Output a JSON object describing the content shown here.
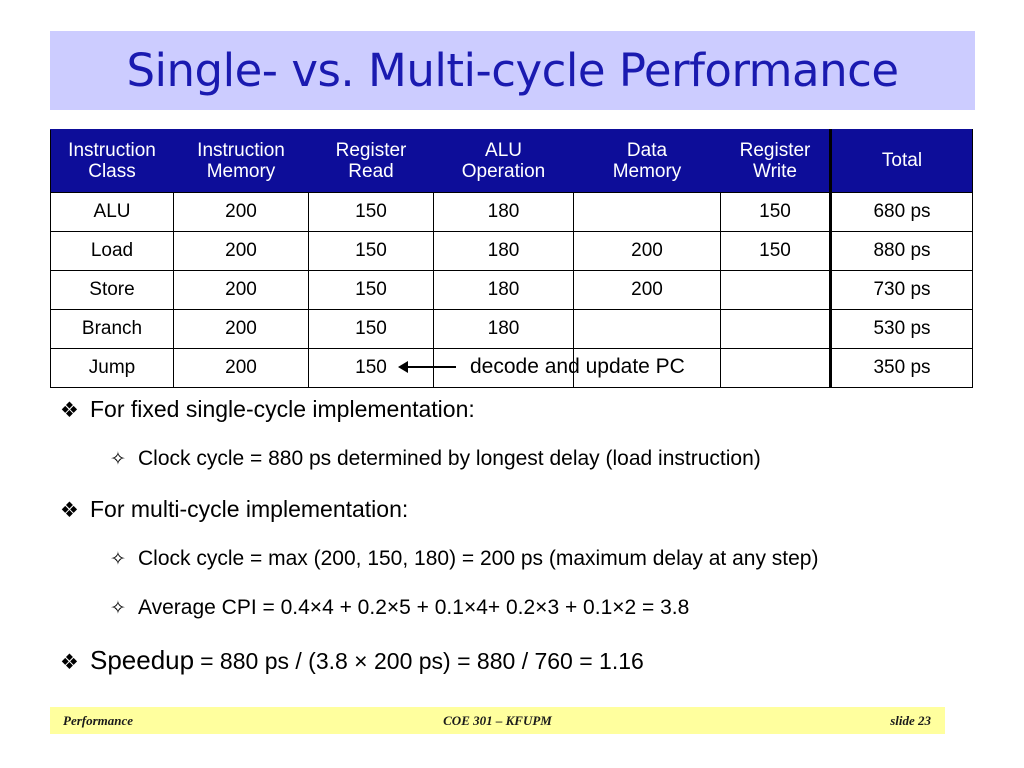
{
  "slide": {
    "title": "Single- vs. Multi-cycle Performance"
  },
  "table": {
    "headers": [
      {
        "line1": "Instruction",
        "line2": "Class"
      },
      {
        "line1": "Instruction",
        "line2": "Memory"
      },
      {
        "line1": "Register",
        "line2": "Read"
      },
      {
        "line1": "ALU",
        "line2": "Operation"
      },
      {
        "line1": "Data",
        "line2": "Memory"
      },
      {
        "line1": "Register",
        "line2": "Write"
      },
      {
        "line1": "Total",
        "line2": ""
      }
    ],
    "rows": [
      {
        "class": "ALU",
        "imem": "200",
        "rread": "150",
        "alu": "180",
        "dmem": "",
        "rwrite": "150",
        "total": "680 ps"
      },
      {
        "class": "Load",
        "imem": "200",
        "rread": "150",
        "alu": "180",
        "dmem": "200",
        "rwrite": "150",
        "total": "880 ps"
      },
      {
        "class": "Store",
        "imem": "200",
        "rread": "150",
        "alu": "180",
        "dmem": "200",
        "rwrite": "",
        "total": "730 ps"
      },
      {
        "class": "Branch",
        "imem": "200",
        "rread": "150",
        "alu": "180",
        "dmem": "",
        "rwrite": "",
        "total": "530 ps"
      },
      {
        "class": "Jump",
        "imem": "200",
        "rread": "150",
        "alu": "",
        "dmem": "",
        "rwrite": "",
        "total": "350 ps"
      }
    ],
    "annotation": {
      "text": "decode and update PC",
      "arrow": "left-arrow-icon"
    }
  },
  "bullets": [
    {
      "level": 1,
      "marker": "❖",
      "marker_name": "filled-diamond-bullet",
      "text": "For fixed single-cycle implementation:"
    },
    {
      "level": 2,
      "marker": "✧",
      "marker_name": "outline-diamond-bullet",
      "text": "Clock cycle = 880 ps determined by longest delay (load instruction)"
    },
    {
      "level": 1,
      "marker": "❖",
      "marker_name": "filled-diamond-bullet",
      "text": "For multi-cycle implementation:"
    },
    {
      "level": 2,
      "marker": "✧",
      "marker_name": "outline-diamond-bullet",
      "text": "Clock cycle = max (200, 150, 180) = 200 ps (maximum delay at any step)"
    },
    {
      "level": 2,
      "marker": "✧",
      "marker_name": "outline-diamond-bullet",
      "text": "Average CPI = 0.4×4 + 0.2×5 + 0.1×4+ 0.2×3 + 0.1×2 = 3.8"
    }
  ],
  "speedup": {
    "marker": "❖",
    "label": "Speedup",
    "equation": "= 880 ps / (3.8 × 200 ps) = 880 / 760 = 1.16"
  },
  "footer": {
    "left": "Performance",
    "center": "COE 301 – KFUPM",
    "right": "slide 23"
  },
  "colors": {
    "title_bg": "#ccccff",
    "title_fg": "#1a1ab0",
    "table_header_bg": "#0d0d99",
    "table_header_fg": "#ffffff",
    "footer_bg": "#ffff9e",
    "body_fg": "#000000"
  }
}
